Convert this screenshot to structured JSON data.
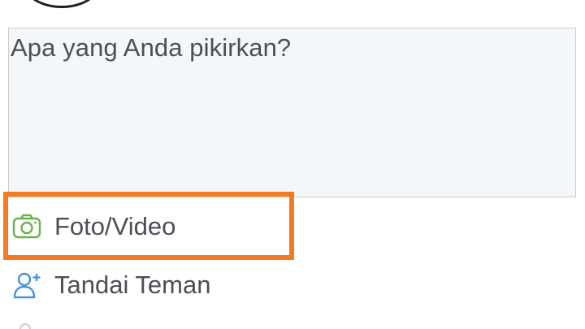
{
  "composer": {
    "placeholder": "Apa yang Anda pikirkan?"
  },
  "options": {
    "photo_video": {
      "label": "Foto/Video",
      "icon": "camera-icon",
      "icon_color": "#6ab04c"
    },
    "tag_friends": {
      "label": "Tandai Teman",
      "icon": "add-person-icon",
      "icon_color": "#4a90d9"
    }
  },
  "colors": {
    "highlight": "#f47b20",
    "composer_bg": "#f5f6f7",
    "text": "#4b4f56"
  }
}
